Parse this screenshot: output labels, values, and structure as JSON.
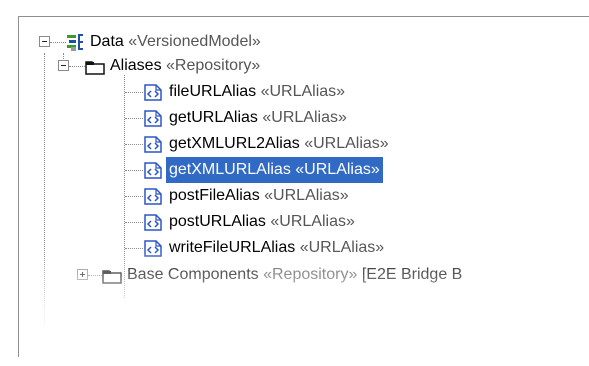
{
  "tree": {
    "root": {
      "name": "Data",
      "stereotype": "«VersionedModel»",
      "icon": "model-icon"
    },
    "folder": {
      "name": "Aliases",
      "stereotype": "«Repository»",
      "icon": "folder-icon"
    },
    "aliases": [
      {
        "name": "fileURLAlias",
        "stereotype": "«URLAlias»",
        "icon": "url-alias-icon"
      },
      {
        "name": "getURLAlias",
        "stereotype": "«URLAlias»",
        "icon": "url-alias-icon"
      },
      {
        "name": "getXMLURL2Alias",
        "stereotype": "«URLAlias»",
        "icon": "url-alias-icon"
      },
      {
        "name": "getXMLURLAlias",
        "stereotype": "«URLAlias»",
        "icon": "url-alias-icon",
        "selected": true
      },
      {
        "name": "postFileAlias",
        "stereotype": "«URLAlias»",
        "icon": "url-alias-icon"
      },
      {
        "name": "postURLAlias",
        "stereotype": "«URLAlias»",
        "icon": "url-alias-icon"
      },
      {
        "name": "writeFileURLAlias",
        "stereotype": "«URLAlias»",
        "icon": "url-alias-icon"
      }
    ],
    "next_folder": {
      "name": "Base Components",
      "stereotype": "«Repository»",
      "suffix": "[E2E Bridge B",
      "icon": "folder-icon"
    }
  },
  "colors": {
    "selection": "#316ac5",
    "alias_icon_border": "#2b55c8",
    "model_icon_green": "#3a9a2a",
    "model_icon_blue": "#1f4fa8"
  }
}
